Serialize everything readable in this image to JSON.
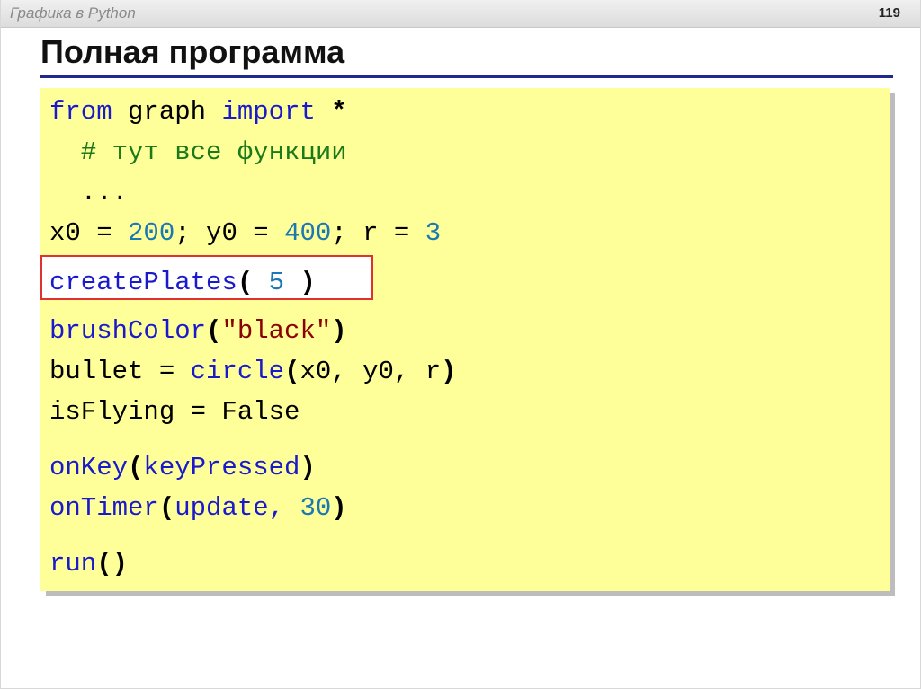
{
  "header": {
    "course": "Графика в Python",
    "page_number": "119"
  },
  "title": "Полная программа",
  "code": {
    "line1": {
      "kw1": "from",
      "mid": " graph ",
      "kw2": "import",
      "star": " *"
    },
    "line2": {
      "comment": "  # тут все функции"
    },
    "line3": {
      "dots": "  ..."
    },
    "line4": {
      "a": "x0 = ",
      "n1": "200",
      "b": "; y0 = ",
      "n2": "400",
      "c": "; r = ",
      "n3": "3"
    },
    "line5": {
      "fn": "createPlates",
      "open": "( ",
      "arg": "5",
      "close": " )"
    },
    "line6": {
      "fn": "brushColor",
      "open": "(",
      "str": "\"black\"",
      "close": ")"
    },
    "line7": {
      "a": "bullet = ",
      "fn": "circle",
      "open": "(",
      "args": "x0, y0, r",
      "close": ")"
    },
    "line8": {
      "text": "isFlying = False"
    },
    "line9": {
      "fn": "onKey",
      "open": "(",
      "arg": "keyPressed",
      "close": ")"
    },
    "line10": {
      "fn": "onTimer",
      "open": "(",
      "arg": "update, ",
      "num": "30",
      "close": ")"
    },
    "line11": {
      "fn": "run",
      "parens": "()"
    }
  },
  "colors": {
    "code_background": "#ffff99",
    "keyword": "#1a1acc",
    "number": "#1a78b4",
    "comment": "#1a7a1a",
    "string": "#8b0000",
    "highlight_border": "#e03030",
    "title_rule": "#1f2a8a"
  }
}
